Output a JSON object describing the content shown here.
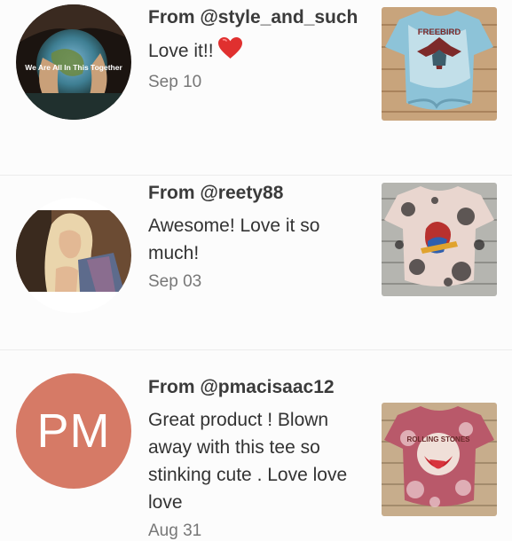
{
  "reviews": [
    {
      "from": "From @style_and_such",
      "text": "Love it!!",
      "date": "Sep 10",
      "avatar_caption": "We Are All In This Together"
    },
    {
      "from": "From @reety88",
      "text": "Awesome! Love it so much!",
      "date": "Sep 03"
    },
    {
      "from": "From @pmacisaac12",
      "text": "Great product ! Blown away with this tee so stinking cute . Love love love",
      "date": "Aug 31",
      "avatar_initials": "PM",
      "avatar_color": "#d67a66"
    }
  ],
  "products": [
    {
      "label": "FREEBIRD"
    },
    {},
    {
      "label": "ROLLING STONES"
    }
  ]
}
